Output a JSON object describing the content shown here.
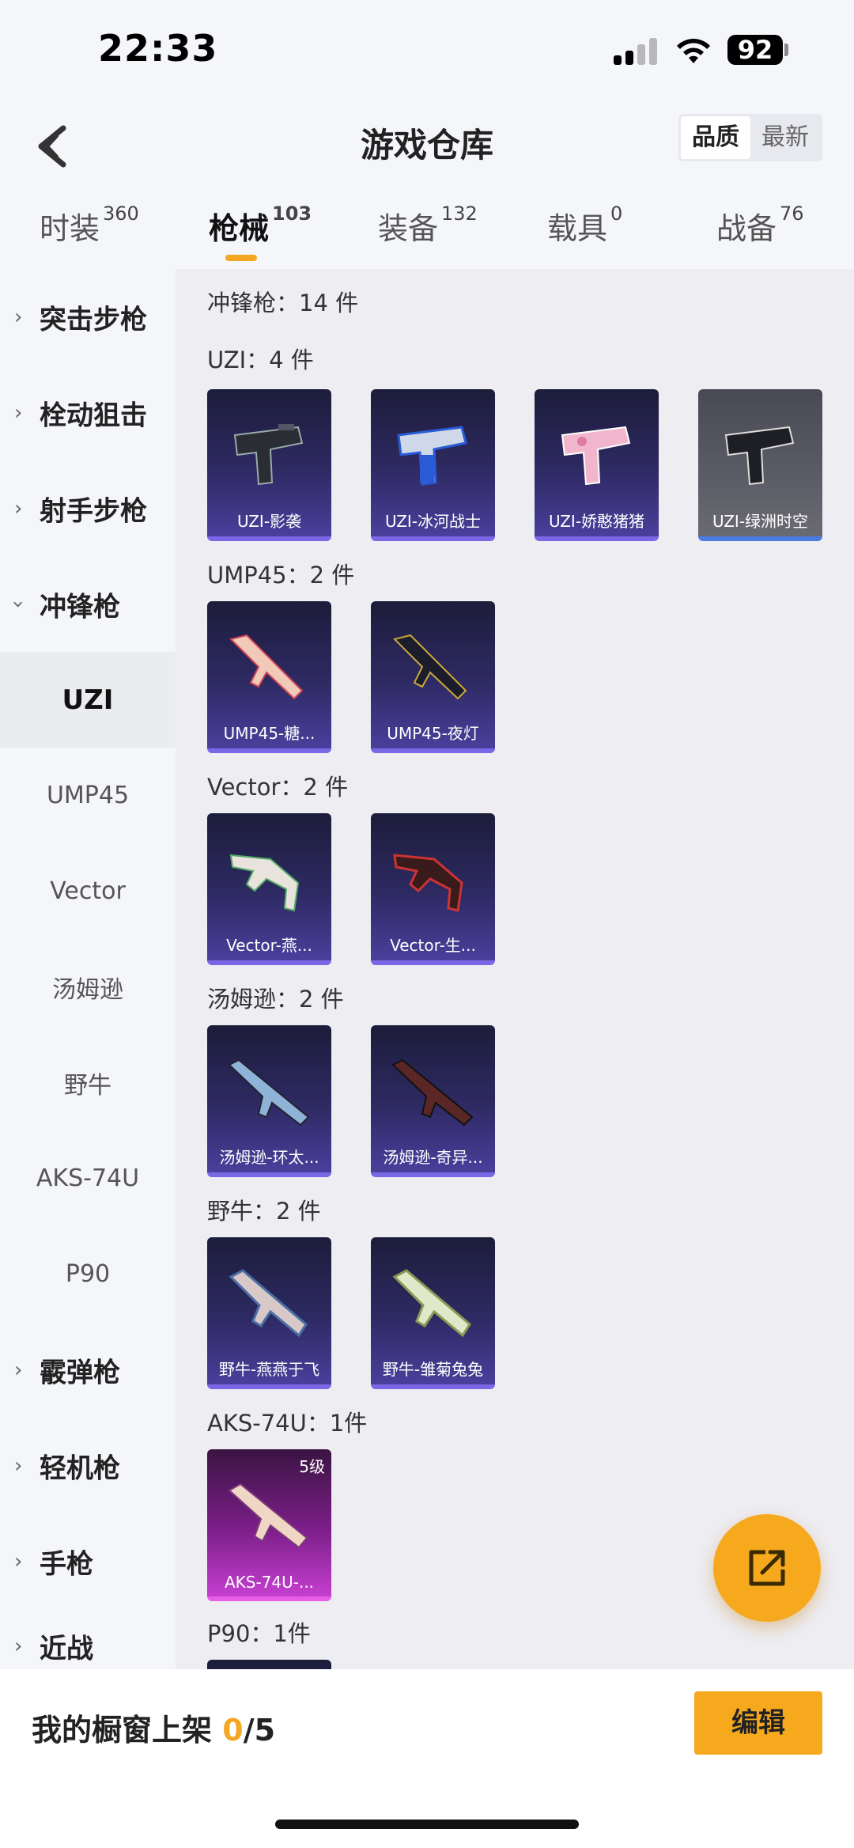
{
  "status": {
    "time": "22:33",
    "battery": "92"
  },
  "header": {
    "title": "游戏仓库",
    "sort": [
      "品质",
      "最新"
    ]
  },
  "tabs": [
    {
      "label": "时装",
      "count": "360"
    },
    {
      "label": "枪械",
      "count": "103"
    },
    {
      "label": "装备",
      "count": "132"
    },
    {
      "label": "载具",
      "count": "0"
    },
    {
      "label": "战备",
      "count": "76"
    }
  ],
  "sidebar": {
    "categories_top": [
      "突击步枪",
      "栓动狙击",
      "射手步枪",
      "冲锋枪"
    ],
    "subs": [
      "UZI",
      "UMP45",
      "Vector",
      "汤姆逊",
      "野牛",
      "AKS-74U",
      "P90"
    ],
    "categories_bottom": [
      "霰弹枪",
      "轻机枪",
      "手枪",
      "近战"
    ]
  },
  "content": {
    "summary": "冲锋枪：14 件",
    "groups": [
      {
        "title": "UZI：4 件",
        "items": [
          "UZI-影袭",
          "UZI-冰河战士",
          "UZI-娇憨猪猪",
          "UZI-绿洲时空"
        ]
      },
      {
        "title": "UMP45：2 件",
        "items": [
          "UMP45-糖...",
          "UMP45-夜灯"
        ]
      },
      {
        "title": "Vector：2 件",
        "items": [
          "Vector-燕...",
          "Vector-生..."
        ]
      },
      {
        "title": "汤姆逊：2 件",
        "items": [
          "汤姆逊-环太...",
          "汤姆逊-奇异..."
        ]
      },
      {
        "title": "野牛：2 件",
        "items": [
          "野牛-燕燕于飞",
          "野牛-雏菊兔兔"
        ]
      },
      {
        "title": "AKS-74U：1件",
        "items": [
          "AKS-74U-..."
        ],
        "level": "5级"
      },
      {
        "title": "P90：1件",
        "items": [
          ""
        ]
      }
    ]
  },
  "bottom": {
    "label": "我的橱窗上架 ",
    "count": "0",
    "total": "/5",
    "edit": "编辑"
  },
  "colors": {
    "accent": "#f7a91d",
    "card_purple": "#4a3f9c",
    "card_pink": "#c43fcf",
    "card_gray": "#5c5c66"
  },
  "icons": {
    "back": "chevron-left-icon",
    "share": "share-out-icon"
  }
}
